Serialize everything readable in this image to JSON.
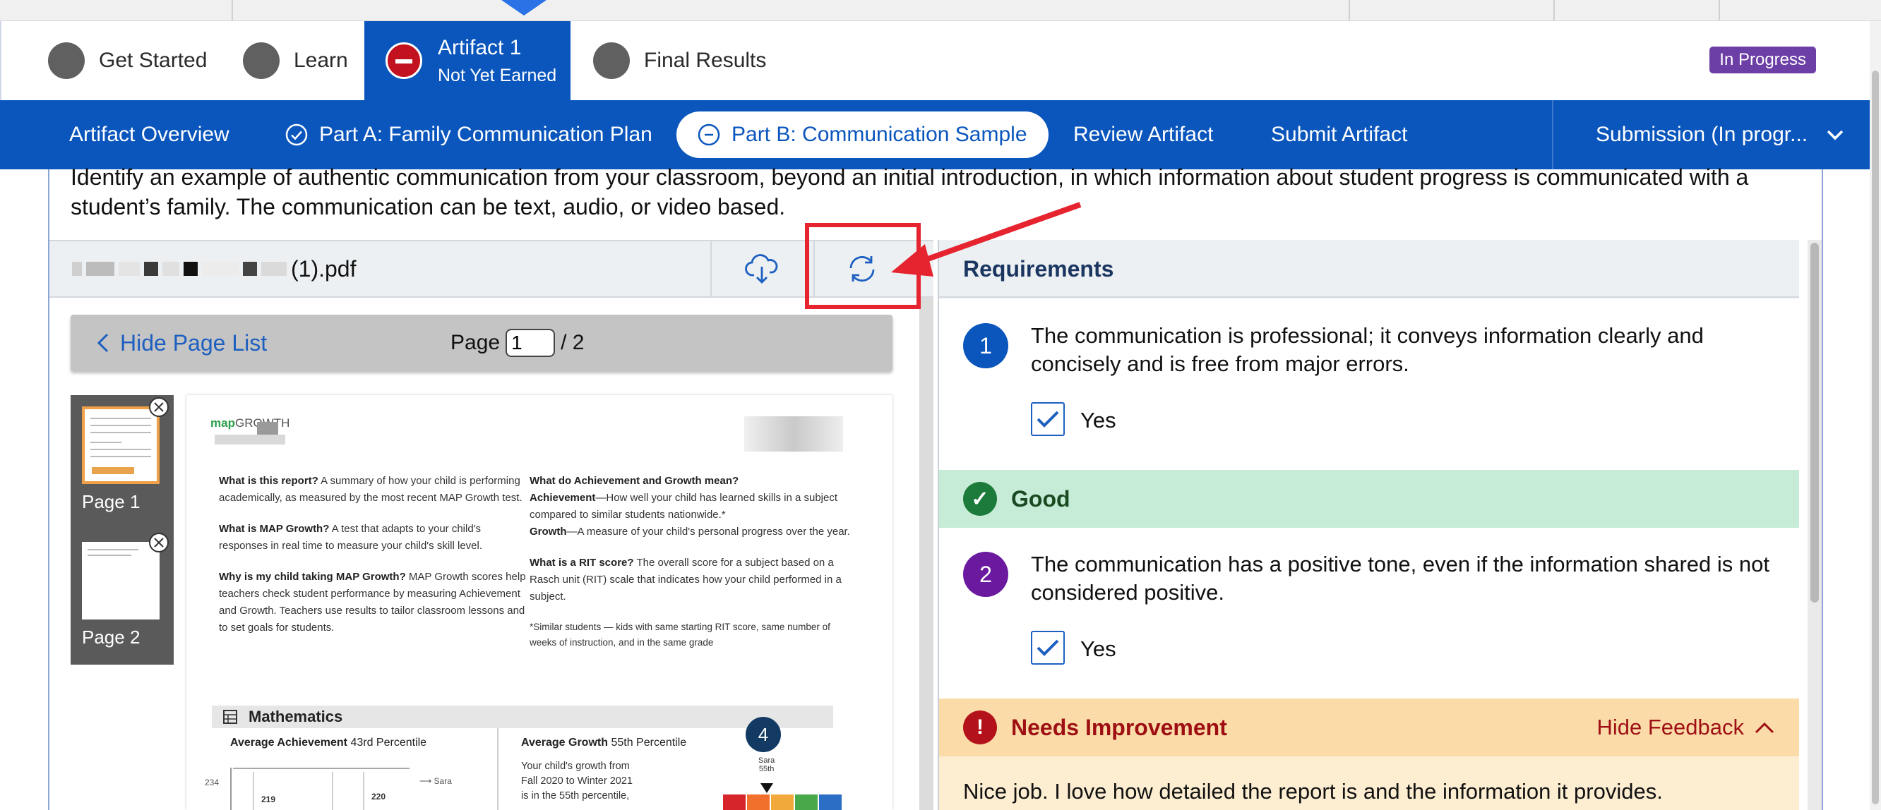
{
  "steps": [
    {
      "label": "Get Started"
    },
    {
      "label": "Learn"
    },
    {
      "label": "Artifact 1",
      "sublabel": "Not Yet Earned"
    },
    {
      "label": "Final Results"
    }
  ],
  "status_badge": "In Progress",
  "tabs": {
    "overview": "Artifact Overview",
    "part_a": "Part A: Family Communication Plan",
    "part_b": "Part B: Communication Sample",
    "review": "Review Artifact",
    "submit": "Submit Artifact",
    "submission": "Submission (In progr..."
  },
  "prompt_text": "Identify an example of authentic communication from your classroom, beyond an initial introduction, in which information about student progress is communicated with a student’s family. The communication can be text, audio, or video based.",
  "file": {
    "name_suffix": "(1).pdf",
    "download_icon": "cloud-download-icon",
    "replace_icon": "refresh-icon"
  },
  "viewer": {
    "hide_page_list": "Hide Page List",
    "page_label": "Page",
    "current_page": "1",
    "total_pages": "/ 2",
    "thumbnails": [
      {
        "label": "Page 1"
      },
      {
        "label": "Page 2"
      }
    ]
  },
  "document": {
    "logo_map": "map",
    "logo_growth": "GROWTH",
    "left_col": [
      {
        "q": "What is this report?",
        "a": " A summary of how your child is performing academically, as measured by the most recent MAP Growth test."
      },
      {
        "q": "What is MAP Growth?",
        "a": " A test that adapts to your child's responses in real time to measure your child's skill level."
      },
      {
        "q": "Why is my child taking MAP Growth?",
        "a": " MAP Growth scores help teachers check student performance by measuring Achievement and Growth. Teachers use results to tailor classroom lessons and to set goals for students."
      }
    ],
    "right_col": [
      {
        "q": "What do Achievement and Growth mean?",
        "a": ""
      },
      {
        "q": "Achievement",
        "a": "—How well your child has learned skills in a subject compared to similar students nationwide.*"
      },
      {
        "q": "Growth",
        "a": "—A measure of your child's personal progress over the year."
      },
      {
        "q": "What is a RIT score?",
        "a": " The overall score for a subject based on a Rasch unit (RIT) scale that indicates how your child performed in a subject."
      }
    ],
    "footnote": "*Similar students — kids with same starting RIT score, same number of weeks of instruction, and in the same grade",
    "math_heading": "Mathematics",
    "avg_achievement_label": "Average Achievement",
    "avg_achievement_value": "43rd Percentile",
    "avg_growth_label": "Average Growth",
    "avg_growth_value": "55th Percentile",
    "growth_text": "Your child's growth from Fall 2020 to Winter 2021 is in the 55th percentile,",
    "chart_y_tick": "234",
    "chart_values": [
      "219",
      "220"
    ],
    "legend_name": "Sara",
    "marker_name": "Sara",
    "marker_value": "55th",
    "bubble_number": "4",
    "growth_bar_colors": [
      "#d7262b",
      "#f0702c",
      "#f2a93b",
      "#49a94a",
      "#2a6fc5"
    ]
  },
  "requirements": {
    "heading": "Requirements",
    "items": [
      {
        "number": "1",
        "text": "The communication is professional; it conveys information clearly and concisely and is free from major errors.",
        "checkbox_label": "Yes",
        "feedback": "Good"
      },
      {
        "number": "2",
        "text": "The communication has a positive tone, even if the information shared is not considered positive.",
        "checkbox_label": "Yes",
        "feedback": "Needs Improvement"
      }
    ],
    "hide_feedback": "Hide Feedback",
    "comment": "Nice job. I love how detailed the report is and the information it provides."
  },
  "colors": {
    "brand_blue": "#0a56bd",
    "not_earned_red": "#c2121f",
    "badge_purple": "#6c3fa6",
    "good_green": "#1c7a3b",
    "needs_improvement_red": "#b3121b",
    "highlight_red": "#e6242f"
  }
}
